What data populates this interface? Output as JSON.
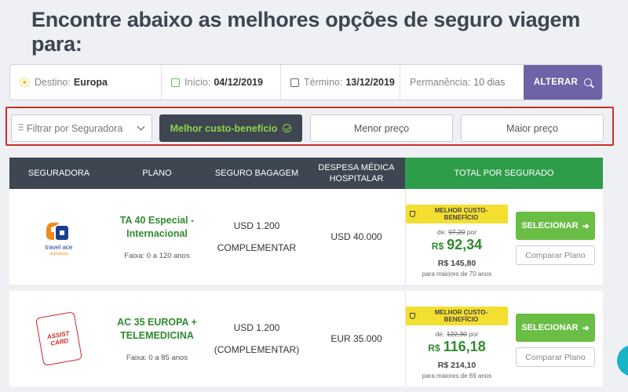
{
  "headline": "Encontre abaixo as melhores opções de seguro viagem para:",
  "search": {
    "destino_label": "Destino:",
    "destino_value": "Europa",
    "inicio_label": "Início:",
    "inicio_value": "04/12/2019",
    "termino_label": "Término:",
    "termino_value": "13/12/2019",
    "permanencia_label": "Permanência:",
    "permanencia_value": "10 dias",
    "alterar_label": "ALTERAR"
  },
  "filters": {
    "select_label": "Filtrar por Seguradora",
    "best_label": "Melhor custo-benefício",
    "lowest_label": "Menor preço",
    "highest_label": "Maior preço"
  },
  "table": {
    "headers": [
      "SEGURADORA",
      "PLANO",
      "SEGURO BAGAGEM",
      "DESPESA MÉDICA HOSPITALAR",
      "TOTAL POR SEGURADO"
    ],
    "rows": [
      {
        "logo_text": [
          "travel ace",
          "assistance"
        ],
        "plan": "TA 40 Especial - Internacional",
        "age": "Faixa: 0 a 120 anos",
        "bag1": "USD 1.200",
        "bag2": "COMPLEMENTAR",
        "medical": "USD 40.000",
        "badge": "MELHOR CUSTO-BENEFÍCIO",
        "was_prefix": "de:",
        "was_value": "97,20",
        "was_suffix": "por",
        "currency": "R$",
        "price": "92,34",
        "other_price": "R$ 145,80",
        "other_note": "para maiores de 70 anos",
        "select_label": "SELECIONAR",
        "compare_label": "Comparar Plano"
      },
      {
        "logo_text": [
          "ASSIST",
          "CARD"
        ],
        "plan": "AC 35 EUROPA + TELEMEDICINA",
        "age": "Faixa: 0 a 85 anos",
        "bag1": "USD 1.200",
        "bag2": "(COMPLEMENTAR)",
        "medical": "EUR 35.000",
        "badge": "MELHOR CUSTO-BENEFÍCIO",
        "was_prefix": "de:",
        "was_value": "122,30",
        "was_suffix": "por",
        "currency": "R$",
        "price": "116,18",
        "other_price": "R$ 214,10",
        "other_note": "para maiores de 69 anos",
        "select_label": "SELECIONAR",
        "compare_label": "Comparar Plano"
      }
    ]
  },
  "colors": {
    "primary_dark": "#3d4651",
    "green": "#6abd45",
    "purple": "#6d63a6",
    "badge_yellow": "#f3df2f",
    "highlight_red": "#c9302c"
  },
  "icons": {
    "location": "map-pin-icon",
    "calendar": "calendar-icon",
    "search": "search-icon",
    "filter": "sliders-icon",
    "check": "check-circle-icon",
    "trophy": "trophy-icon",
    "arrow": "arrow-right-icon",
    "chat": "chat-icon"
  }
}
